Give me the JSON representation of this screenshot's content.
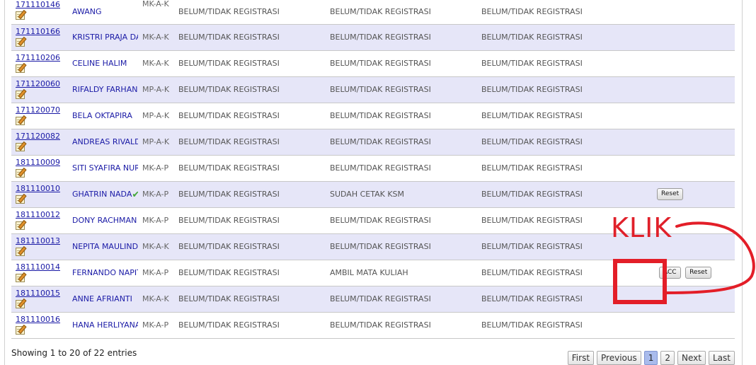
{
  "rows": [
    {
      "nim": "171110146",
      "name": "AWANG",
      "code": "MK-A-K",
      "s1": "BELUM/TIDAK REGISTRASI",
      "s2": "BELUM/TIDAK REGISTRASI",
      "s3": "BELUM/TIDAK REGISTRASI"
    },
    {
      "nim": "171110166",
      "name": "KRISTRI PRAJA DARMAWATI",
      "code": "MK-A-K",
      "s1": "BELUM/TIDAK REGISTRASI",
      "s2": "BELUM/TIDAK REGISTRASI",
      "s3": "BELUM/TIDAK REGISTRASI"
    },
    {
      "nim": "171110206",
      "name": "CELINE HALIM",
      "code": "MK-A-K",
      "s1": "BELUM/TIDAK REGISTRASI",
      "s2": "BELUM/TIDAK REGISTRASI",
      "s3": "BELUM/TIDAK REGISTRASI"
    },
    {
      "nim": "171120060",
      "name": "RIFALDY FARHAN M",
      "code": "MP-A-K",
      "s1": "BELUM/TIDAK REGISTRASI",
      "s2": "BELUM/TIDAK REGISTRASI",
      "s3": "BELUM/TIDAK REGISTRASI"
    },
    {
      "nim": "171120070",
      "name": "BELA OKTAPIRA",
      "code": "MP-A-K",
      "s1": "BELUM/TIDAK REGISTRASI",
      "s2": "BELUM/TIDAK REGISTRASI",
      "s3": "BELUM/TIDAK REGISTRASI"
    },
    {
      "nim": "171120082",
      "name": "ANDREAS RIVALDY",
      "code": "MP-A-K",
      "s1": "BELUM/TIDAK REGISTRASI",
      "s2": "BELUM/TIDAK REGISTRASI",
      "s3": "BELUM/TIDAK REGISTRASI"
    },
    {
      "nim": "181110009",
      "name": "SITI SYAFIRA NURCAHYA",
      "code": "MK-A-P",
      "s1": "BELUM/TIDAK REGISTRASI",
      "s2": "BELUM/TIDAK REGISTRASI",
      "s3": "BELUM/TIDAK REGISTRASI"
    },
    {
      "nim": "181110010",
      "name": "GHATRIN NADA",
      "code": "MK-A-P",
      "s1": "BELUM/TIDAK REGISTRASI",
      "s2": "SUDAH CETAK KSM",
      "s3": "BELUM/TIDAK REGISTRASI",
      "reset_label": "Reset"
    },
    {
      "nim": "181110012",
      "name": "DONY RACHMAN",
      "code": "MK-A-P",
      "s1": "BELUM/TIDAK REGISTRASI",
      "s2": "BELUM/TIDAK REGISTRASI",
      "s3": "BELUM/TIDAK REGISTRASI"
    },
    {
      "nim": "181110013",
      "name": "NEPITA MAULINDA",
      "code": "MK-A-K",
      "s1": "BELUM/TIDAK REGISTRASI",
      "s2": "BELUM/TIDAK REGISTRASI",
      "s3": "BELUM/TIDAK REGISTRASI"
    },
    {
      "nim": "181110014",
      "name": "FERNANDO NAPITUPULU",
      "code": "MK-A-P",
      "s1": "BELUM/TIDAK REGISTRASI",
      "s2": "AMBIL MATA KULIAH",
      "s3": "BELUM/TIDAK REGISTRASI",
      "acc_label": "ACC",
      "reset_label": "Reset"
    },
    {
      "nim": "181110015",
      "name": "ANNE AFRIANTI",
      "code": "MK-A-K",
      "s1": "BELUM/TIDAK REGISTRASI",
      "s2": "BELUM/TIDAK REGISTRASI",
      "s3": "BELUM/TIDAK REGISTRASI"
    },
    {
      "nim": "181110016",
      "name": "HANA HERLIYANA",
      "code": "MK-A-P",
      "s1": "BELUM/TIDAK REGISTRASI",
      "s2": "BELUM/TIDAK REGISTRASI",
      "s3": "BELUM/TIDAK REGISTRASI"
    }
  ],
  "footer": {
    "info": "Showing 1 to 20 of 22 entries",
    "pager": {
      "first": "First",
      "previous": "Previous",
      "page1": "1",
      "page2": "2",
      "next": "Next",
      "last": "Last",
      "current_page": 1
    }
  },
  "annotation": {
    "text": "KLIK",
    "color": "#e31e28"
  },
  "colors": {
    "row_even_bg": "#e6e6f8",
    "link": "#1a1aa6",
    "active_page": "#a9bbec"
  }
}
